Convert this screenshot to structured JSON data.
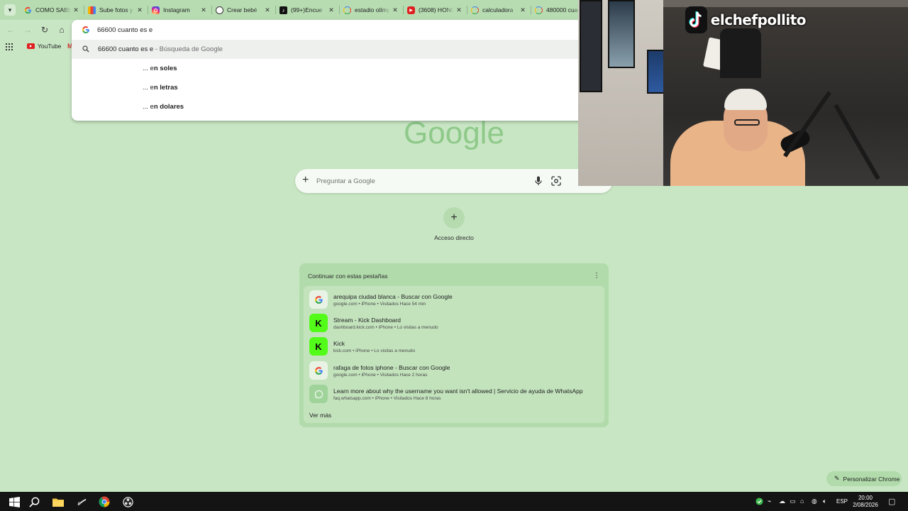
{
  "tabs": [
    {
      "title": "COMO SABER",
      "favicon": "google-icon",
      "color": "#ffffff"
    },
    {
      "title": "Sube fotos y",
      "favicon": "color-grid-icon",
      "color": "#e5b700"
    },
    {
      "title": "Instagram",
      "favicon": "instagram-icon",
      "color": "#d62976"
    },
    {
      "title": "Crear bebé",
      "favicon": "openai-icon",
      "color": "#ffffff"
    },
    {
      "title": "(99+)Encue",
      "favicon": "tiktok-icon",
      "color": "#111111"
    },
    {
      "title": "estadio olímp",
      "favicon": "google-icon",
      "color": "#ffffff"
    },
    {
      "title": "(3608) HONO",
      "favicon": "youtube-icon",
      "color": "#e02020"
    },
    {
      "title": "calculadora",
      "favicon": "google-icon",
      "color": "#ffffff"
    },
    {
      "title": "480000 cua",
      "favicon": "google-icon",
      "color": "#ffffff"
    }
  ],
  "omnibox": {
    "query": "66600 cuanto es e",
    "suggestions": [
      {
        "prefix": "66600 cuanto es e",
        "suffix": " - Búsqueda de Google"
      },
      {
        "prefix": "... e",
        "bold": "n soles"
      },
      {
        "prefix": "... e",
        "bold": "n letras"
      },
      {
        "prefix": "... e",
        "bold": "n dolares"
      }
    ]
  },
  "bookmarks": {
    "youtube": "YouTube",
    "gmail": "M"
  },
  "ntp": {
    "logo": "Google",
    "search_placeholder": "Preguntar a Google",
    "shortcut_label": "Acceso directo",
    "shortcut_plus": "+",
    "card": {
      "title": "Continuar con estas pestañas",
      "see_more": "Ver más",
      "items": [
        {
          "icon": "google-icon",
          "title": "arequipa ciudad blanca - Buscar con Google",
          "meta": "google.com • iPhone • Visitados Hace 54 min"
        },
        {
          "icon": "kick-icon",
          "title": "Stream - Kick Dashboard",
          "meta": "dashboard.kick.com • iPhone • Lo visitas a menudo"
        },
        {
          "icon": "kick-icon",
          "title": "Kick",
          "meta": "kick.com • iPhone • Lo visitas a menudo"
        },
        {
          "icon": "google-icon",
          "title": "rafaga de fotos iphone - Buscar con Google",
          "meta": "google.com • iPhone • Visitados Hace 2 horas"
        },
        {
          "icon": "whatsapp-icon",
          "title": "Learn more about why the username you want isn't allowed | Servicio de ayuda de WhatsApp",
          "meta": "faq.whatsapp.com • iPhone • Visitados Hace 8 horas"
        }
      ]
    },
    "customize": "Personalizar Chrome"
  },
  "overlay": {
    "tiktok_username": "elchefpollito"
  },
  "taskbar": {
    "language": "ESP",
    "time": "20:00",
    "date": "2/08/2026"
  },
  "colors": {
    "page_bg": "#c8e6c4",
    "tab_strip": "#b7dcb2",
    "card_bg": "#b1dbab",
    "kick_green": "#53fc18",
    "taskbar": "#141414"
  }
}
